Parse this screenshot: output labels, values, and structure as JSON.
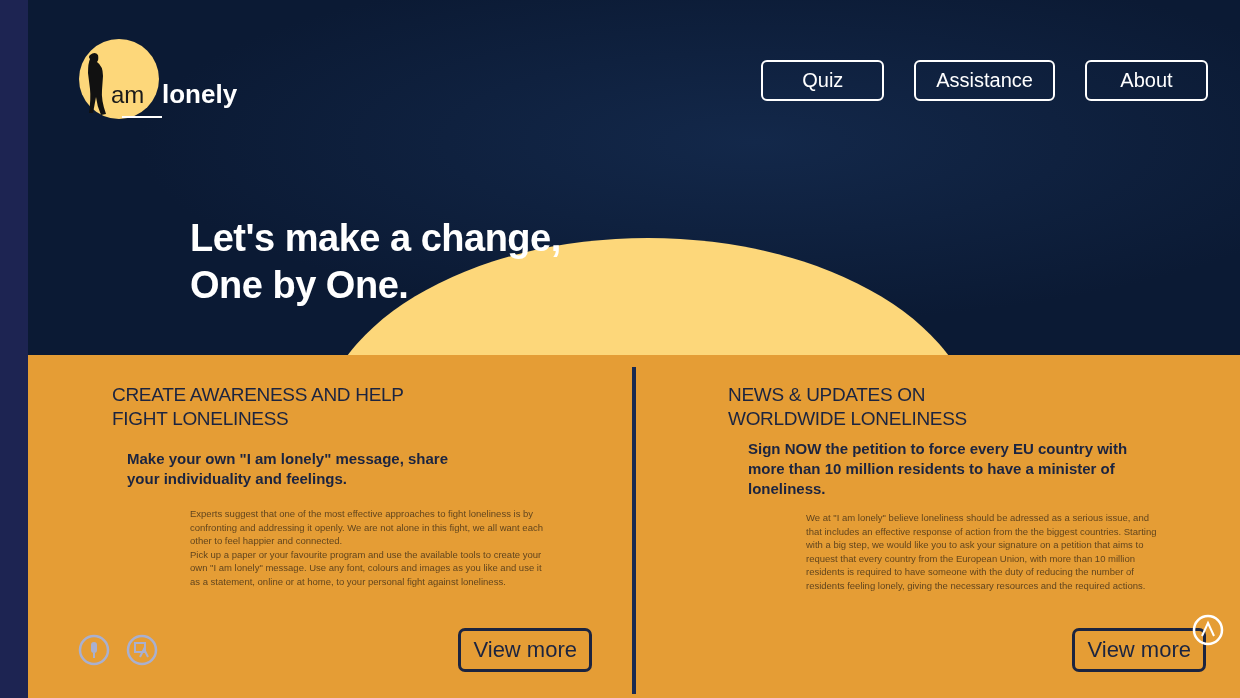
{
  "logo": {
    "word_1": "am",
    "word_2": "lonely"
  },
  "nav": [
    {
      "label": "Quiz"
    },
    {
      "label": "Assistance"
    },
    {
      "label": "About"
    }
  ],
  "hero": {
    "line_1": "Let's make a change,",
    "line_2": "One by One."
  },
  "panels": [
    {
      "heading": "CREATE AWARENESS AND HELP FIGHT LONELINESS",
      "lead": "Make your own \"I am lonely\" message, share your individuality and feelings.",
      "paragraphs": [
        "Experts suggest that one of the most effective approaches to fight loneliness is by confronting and addressing it openly. We are not alone in this fight, we all want each other to feel happier and connected.",
        "Pick up a paper or your favourite program and use the available tools to create your own \"I am lonely\" message. Use any font, colours and images as you like and use it as a statement, online or at home, to your personal fight against loneliness."
      ],
      "tools": true,
      "button": "View more"
    },
    {
      "heading": "NEWS & UPDATES ON WORLDWIDE LONELINESS",
      "lead": "Sign NOW the petition to force every EU country with more than 10 million residents to have a minister of loneliness.",
      "paragraphs": [
        "We at \"I am lonely\" believe loneliness should be adressed as a serious issue, and that includes an effective response of action from the the biggest countries. Starting with a big step, we would like you to ask your signature on a petition that aims to request that every country from the European Union, with more than 10 million residents is required to have someone with the duty of reducing the number of residents feeling lonely, giving the necessary resources and the required actions."
      ],
      "tools": false,
      "button": "View more"
    }
  ]
}
